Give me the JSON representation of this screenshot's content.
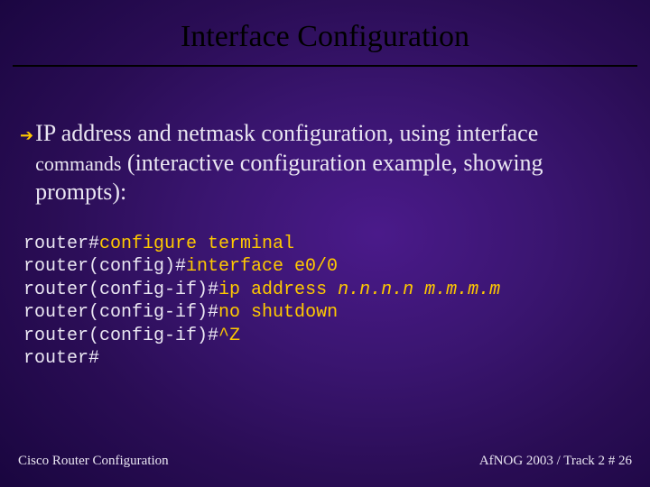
{
  "title": "Interface Configuration",
  "bullet": {
    "line": "IP address and netmask configuration, using interface",
    "smallword": "commands",
    "rest": " (interactive configuration example, showing prompts):"
  },
  "code": {
    "p1": "router#",
    "c1": "configure terminal",
    "p2": "router(config)#",
    "c2": "interface e0/0",
    "p3": "router(config-if)#",
    "c3a": "ip address ",
    "c3b": "n.n.n.n m.m.m.m",
    "p4": "router(config-if)#",
    "c4": "no shutdown",
    "p5": "router(config-if)#",
    "c5": "^Z",
    "p6": "router#"
  },
  "footer": {
    "left": "Cisco Router Configuration",
    "right": "AfNOG 2003 / Track 2  # 26"
  }
}
